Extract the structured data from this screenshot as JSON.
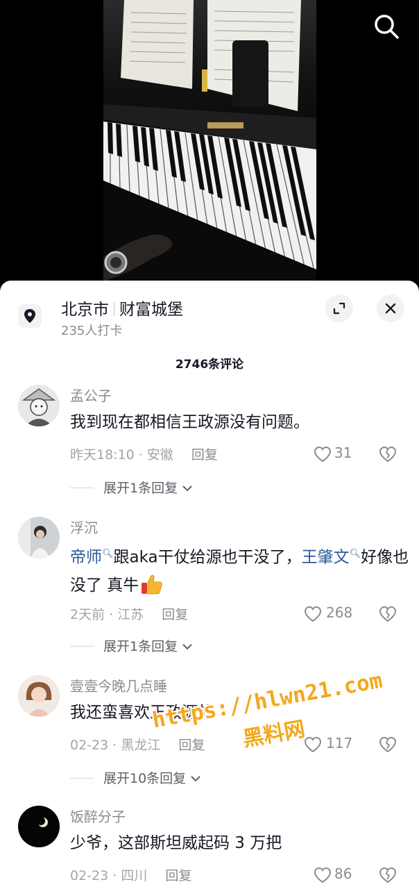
{
  "video": {
    "description_icon": "piano-video"
  },
  "top_bar": {
    "search_icon": "search-icon"
  },
  "location": {
    "city": "北京市",
    "place": "财富城堡",
    "checkins": "235人打卡"
  },
  "comments_header": {
    "count_label": "2746条评论"
  },
  "comments": [
    {
      "user": "孟公子",
      "text": "我到现在都相信王政源没有问题。",
      "time_location": "昨天18:10 · 安徽",
      "reply_label": "回复",
      "likes": "31",
      "expand_label": "展开1条回复"
    },
    {
      "user": "浮沉",
      "mention1": "帝师",
      "text_mid": "跟aka干仗给源也干没了，",
      "mention2": "王肇文",
      "text_end": "好像也没了 真牛",
      "time_location": "2天前 · 江苏",
      "reply_label": "回复",
      "likes": "268",
      "expand_label": "展开1条回复"
    },
    {
      "user": "壹壹今晚几点睡",
      "text": "我还蛮喜欢王政源的",
      "time_location": "02-23 · 黑龙江",
      "reply_label": "回复",
      "likes": "117",
      "expand_label": "展开10条回复"
    },
    {
      "user": "饭醉分子",
      "text": "少爷，这部斯坦威起码 3 万把",
      "time_location": "02-23 · 四川",
      "reply_label": "回复",
      "likes": "86"
    }
  ],
  "watermark": {
    "url": "https://hlwn21.com",
    "name": "黑料网"
  },
  "colors": {
    "mention": "#2d5b9a",
    "watermark": "#f2a81d",
    "muted": "#8a8b91"
  }
}
